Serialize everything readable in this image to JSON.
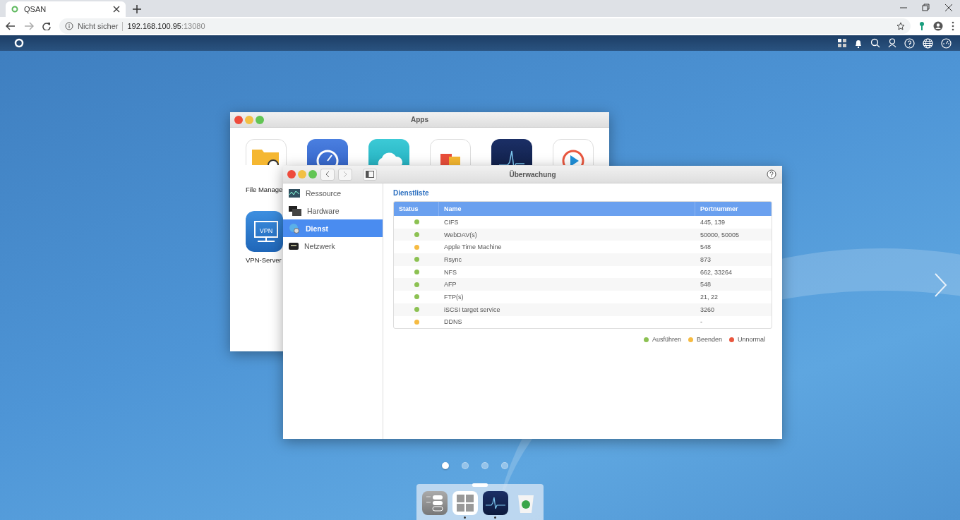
{
  "browser": {
    "tab_title": "QSAN",
    "security": "Nicht sicher",
    "url_host": "192.168.100.95",
    "url_port": ":13080"
  },
  "apps_window": {
    "title": "Apps",
    "apps": [
      {
        "kind": "files",
        "label": "File Manage"
      },
      {
        "kind": "backup"
      },
      {
        "kind": "cloud"
      },
      {
        "kind": "blocks"
      },
      {
        "kind": "monitor"
      },
      {
        "kind": "media"
      },
      {
        "kind": "vpn",
        "label": "VPN-Server",
        "icon_text": "VPN"
      }
    ]
  },
  "monitor_window": {
    "title": "Überwachung",
    "sidebar": [
      {
        "kind": "resource",
        "label": "Ressource",
        "selected": false
      },
      {
        "kind": "hardware",
        "label": "Hardware",
        "selected": false
      },
      {
        "kind": "service",
        "label": "Dienst",
        "selected": true
      },
      {
        "kind": "network",
        "label": "Netzwerk",
        "selected": false
      }
    ],
    "section_title": "Dienstliste",
    "columns": [
      "Status",
      "Name",
      "Portnummer"
    ],
    "rows": [
      {
        "color": "#8cc152",
        "name": "CIFS",
        "port": "445, 139"
      },
      {
        "color": "#8cc152",
        "name": "WebDAV(s)",
        "port": "50000, 50005"
      },
      {
        "color": "#f6bb42",
        "name": "Apple Time Machine",
        "port": "548"
      },
      {
        "color": "#8cc152",
        "name": "Rsync",
        "port": "873"
      },
      {
        "color": "#8cc152",
        "name": "NFS",
        "port": "662, 33264"
      },
      {
        "color": "#8cc152",
        "name": "AFP",
        "port": "548"
      },
      {
        "color": "#8cc152",
        "name": "FTP(s)",
        "port": "21, 22"
      },
      {
        "color": "#8cc152",
        "name": "iSCSI target service",
        "port": "3260"
      },
      {
        "color": "#f6bb42",
        "name": "DDNS",
        "port": "-"
      }
    ],
    "legend": [
      {
        "color": "#8cc152",
        "label": "Ausführen"
      },
      {
        "color": "#f6bb42",
        "label": "Beenden"
      },
      {
        "color": "#e9573f",
        "label": "Unnormal"
      }
    ]
  },
  "page_dots": [
    {
      "selected": true
    },
    {
      "selected": false
    },
    {
      "selected": false
    },
    {
      "selected": false
    }
  ],
  "dock": [
    {
      "kind": "settings",
      "running": false
    },
    {
      "kind": "apps",
      "running": true
    },
    {
      "kind": "monitor",
      "running": true
    },
    {
      "kind": "trash",
      "running": false
    }
  ]
}
